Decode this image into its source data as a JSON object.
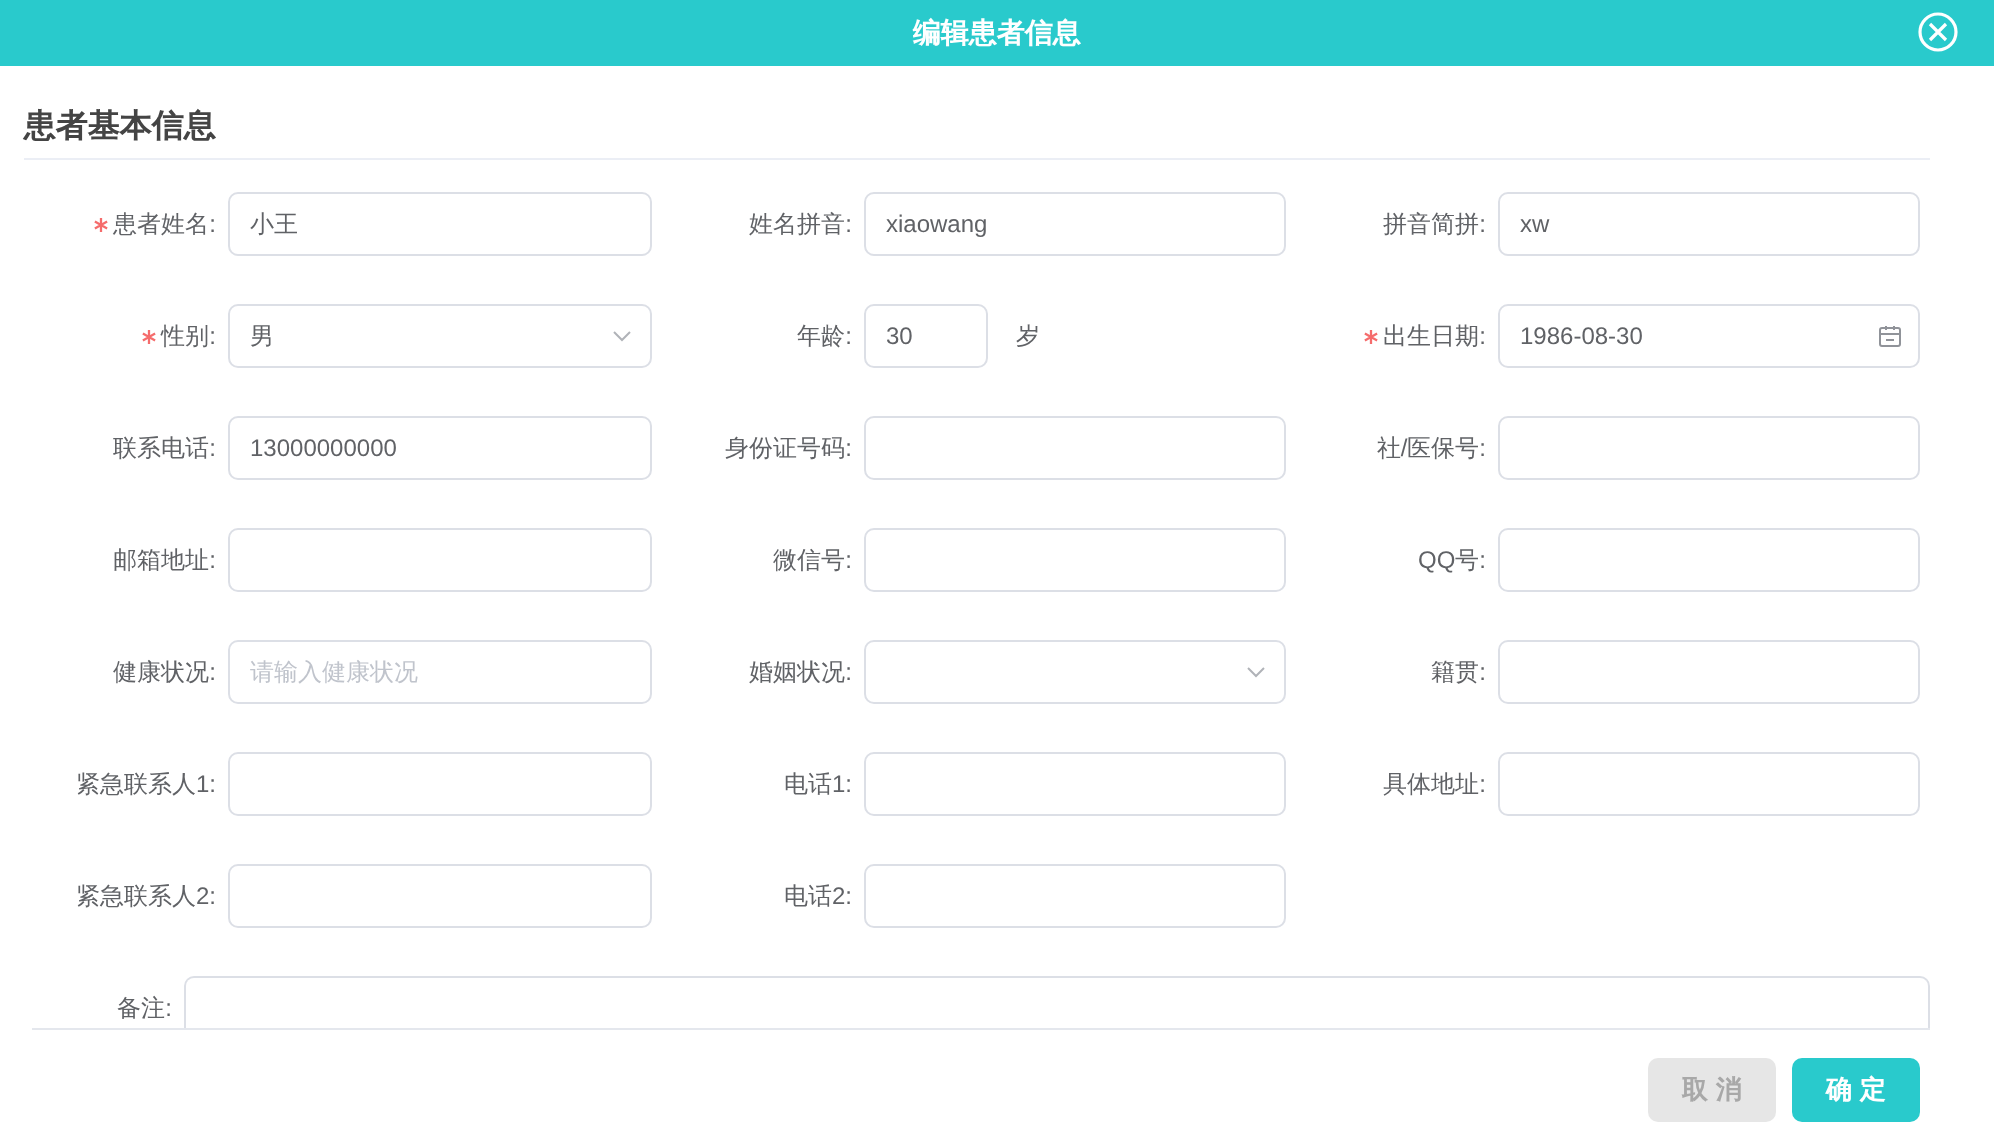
{
  "window": {
    "title": "编辑患者信息"
  },
  "section": {
    "title": "患者基本信息"
  },
  "rows": [
    [
      {
        "label": "患者姓名:",
        "kind": "text",
        "required": true,
        "value": "小王"
      },
      {
        "label": "姓名拼音:",
        "kind": "text",
        "required": false,
        "value": "xiaowang"
      },
      {
        "label": "拼音简拼:",
        "kind": "text",
        "required": false,
        "value": "xw"
      }
    ],
    [
      {
        "label": "性别:",
        "kind": "select",
        "required": true,
        "value": "男"
      },
      {
        "label": "年龄:",
        "kind": "number",
        "required": false,
        "value": "30",
        "unit": "岁"
      },
      {
        "label": "出生日期:",
        "kind": "date",
        "required": true,
        "value": "1986-08-30"
      }
    ],
    [
      {
        "label": "联系电话:",
        "kind": "text",
        "required": false,
        "value": "13000000000"
      },
      {
        "label": "身份证号码:",
        "kind": "text",
        "required": false
      },
      {
        "label": "社/医保号:",
        "kind": "text",
        "required": false
      }
    ],
    [
      {
        "label": "邮箱地址:",
        "kind": "text",
        "required": false
      },
      {
        "label": "微信号:",
        "kind": "text",
        "required": false
      },
      {
        "label": "QQ号:",
        "kind": "text",
        "required": false
      }
    ],
    [
      {
        "label": "健康状况:",
        "kind": "text",
        "required": false,
        "placeholder": "请输入健康状况"
      },
      {
        "label": "婚姻状况:",
        "kind": "select",
        "required": false
      },
      {
        "label": "籍贯:",
        "kind": "text",
        "required": false
      }
    ],
    [
      {
        "label": "紧急联系人1:",
        "kind": "text",
        "required": false
      },
      {
        "label": "电话1:",
        "kind": "text",
        "required": false
      },
      {
        "label": "具体地址:",
        "kind": "text",
        "required": false
      }
    ],
    [
      {
        "label": "紧急联系人2:",
        "kind": "text",
        "required": false
      },
      {
        "label": "电话2:",
        "kind": "text",
        "required": false
      }
    ]
  ],
  "remark": {
    "label": "备注:"
  },
  "buttons": [
    {
      "label": "取消",
      "kind": "cancel",
      "disabled": true
    },
    {
      "label": "确定",
      "kind": "confirm",
      "disabled": false
    }
  ]
}
